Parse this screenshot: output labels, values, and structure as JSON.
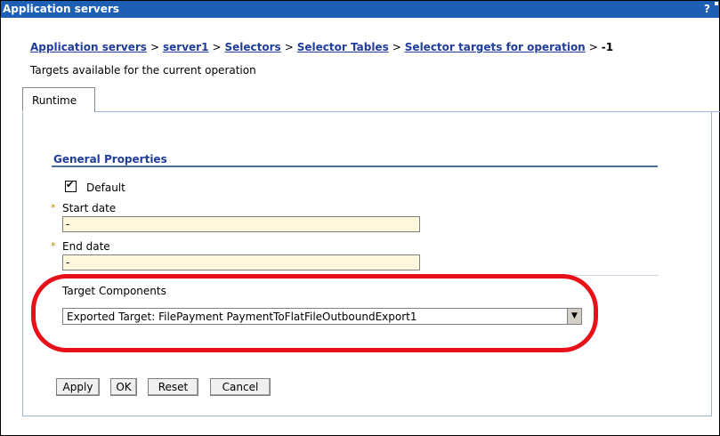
{
  "window": {
    "title": "Application servers",
    "help_glyph": "?"
  },
  "breadcrumb": {
    "items": [
      "Application servers",
      "server1",
      "Selectors",
      "Selector Tables",
      "Selector targets for operation"
    ],
    "separator": ">",
    "current": "-1"
  },
  "description": "Targets available for the current operation",
  "tabs": [
    {
      "label": "Runtime"
    }
  ],
  "general_properties": {
    "title": "General Properties",
    "default_label": "Default",
    "default_checked": true,
    "required_marker": "*",
    "start_date_label": "Start date",
    "start_date_value": "-",
    "end_date_label": "End date",
    "end_date_value": "-"
  },
  "target_components": {
    "label": "Target Components",
    "selected": "Exported Target: FilePayment PaymentToFlatFileOutboundExport1",
    "arrow_glyph": "▼"
  },
  "buttons": {
    "apply": "Apply",
    "ok": "OK",
    "reset": "Reset",
    "cancel": "Cancel"
  },
  "colors": {
    "titlebar": "#1c5fb4",
    "link": "#1f3d99",
    "input_bg": "#fff7dc",
    "highlight": "#e8111a"
  }
}
